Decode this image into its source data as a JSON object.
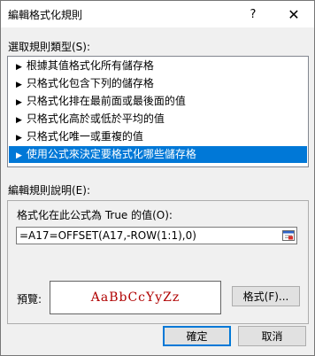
{
  "window": {
    "title": "編輯格式化規則",
    "help_label": "?",
    "close_label": "✕"
  },
  "rule_type": {
    "label": "選取規則類型(S):",
    "items": [
      "根據其值格式化所有儲存格",
      "只格式化包含下列的儲存格",
      "只格式化排在最前面或最後面的值",
      "只格式化高於或低於平均的值",
      "只格式化唯一或重複的值",
      "使用公式來決定要格式化哪些儲存格"
    ],
    "selected_index": 5,
    "bullet": "▶"
  },
  "rule_desc": {
    "label": "編輯規則說明(E):",
    "formula_label": "格式化在此公式為 True 的值(O):",
    "formula_value": "=A17=OFFSET(A17,-ROW(1:1),0)",
    "preview_label": "預覽:",
    "preview_text": "AaBbCcYyZz",
    "format_button": "格式(F)..."
  },
  "buttons": {
    "ok": "確定",
    "cancel": "取消"
  },
  "colors": {
    "selection": "#0078d7",
    "preview_text": "#b00000"
  }
}
